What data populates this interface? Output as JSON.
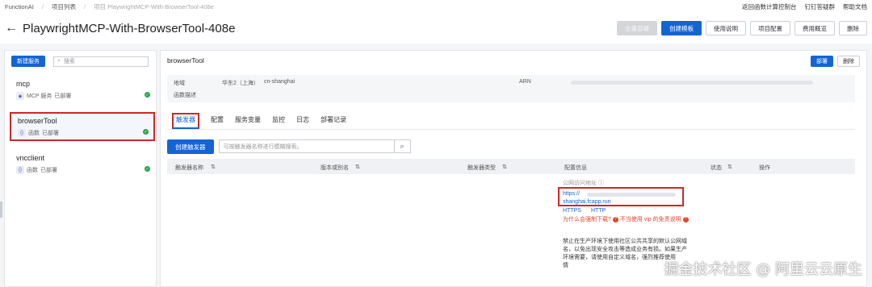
{
  "topbar": {
    "breadcrumb": [
      "FunctionAI",
      "项目列表",
      "项目 PlaywrightMCP-With-BrowserTool-408e"
    ],
    "links": [
      "返回函数计算控制台",
      "钉钉答疑群",
      "帮助文档"
    ]
  },
  "header": {
    "title": "PlaywrightMCP-With-BrowserTool-408e",
    "buttons": [
      "全量部署",
      "创建模板",
      "使用说明",
      "项目配置",
      "费用概览",
      "删除"
    ]
  },
  "sidebar": {
    "new_service": "新建服务",
    "search_placeholder": "搜索",
    "services": [
      {
        "name": "mcp",
        "type": "MCP 服务",
        "status": "已部署"
      },
      {
        "name": "browserTool",
        "type": "函数",
        "status": "已部署"
      },
      {
        "name": "vncclient",
        "type": "函数",
        "status": "已部署"
      }
    ]
  },
  "main": {
    "title": "browserTool",
    "deploy": "部署",
    "delete": "删除",
    "info": {
      "region_label": "地域",
      "region_value": "华东2（上海）",
      "region_id": "cn-shanghai",
      "arn_label": "ARN",
      "desc_label": "函数描述"
    },
    "tabs": [
      "触发器",
      "配置",
      "服务变量",
      "监控",
      "日志",
      "部署记录"
    ],
    "create_trigger": "创建触发器",
    "trigger_search_placeholder": "可按触发器名称进行模糊搜索。",
    "columns": [
      "触发器名称",
      "版本或别名",
      "触发器类型",
      "配置信息",
      "状态",
      "操作"
    ],
    "config": {
      "label": "公网访问地址",
      "url_line1": "https://",
      "url_line2": "shanghai.fcapp.run",
      "link_https": "HTTPS",
      "link_http": "HTTP",
      "warn_q": "为什么会强制下载?",
      "warn_vip": "不当使用 vip 的免责说明",
      "note": "禁止在生产环境下使用社区公共共享的默认公网域名，以免出现安全攻击等造成业务有损。如果生产环境需要，请使用自定义域名，强烈推荐使用",
      "note_tail": "情"
    }
  },
  "watermark": "掘金技术社区 @ 阿里云云原生"
}
